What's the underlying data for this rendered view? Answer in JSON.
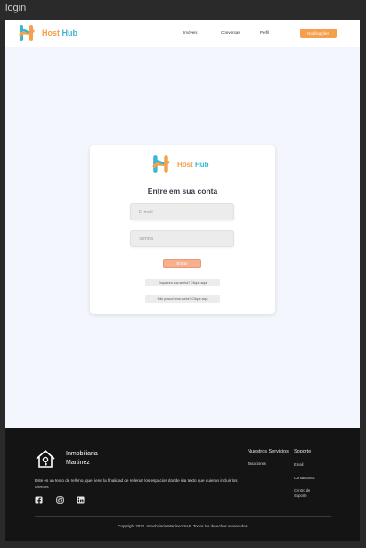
{
  "window": {
    "title": "login"
  },
  "brand": {
    "host": "Host",
    "hub": "Hub"
  },
  "nav": {
    "items": [
      "Imóveis",
      "Conversas",
      "Perfil"
    ],
    "notifications": "Notificações"
  },
  "login": {
    "title": "Entre em sua conta",
    "email_placeholder": "E-mail",
    "password_placeholder": "Senha",
    "submit_label": "Entrar",
    "forgot_label": "Esqueceu sua senha? Clique aqui",
    "signup_label": "Não possui uma conta? Clique aqui"
  },
  "footer": {
    "company_line1": "Inmobiliaria",
    "company_line2": "Martinez",
    "description": "Este es un texto de relleno, que tiene la finalidad de rellenar los espacios donde irìa texto que quieran incluir los clientes",
    "social_icons": [
      "facebook-icon",
      "instagram-icon",
      "linkedin-icon"
    ],
    "services_title": "Nuestros Servicios",
    "services_items": [
      "Tasaciones"
    ],
    "support_title": "Soporte",
    "support_items": [
      "Email",
      "Contactanos",
      "Centro de Soporte"
    ],
    "copyright": "Copyright 2022. Inmobiliaria Martinez SaS. Todos los derechos reservados"
  },
  "colors": {
    "accent": "#f5a04a",
    "brand_blue": "#39b6d6",
    "page_bg": "#f4f6fd",
    "footer_bg": "#141414"
  }
}
